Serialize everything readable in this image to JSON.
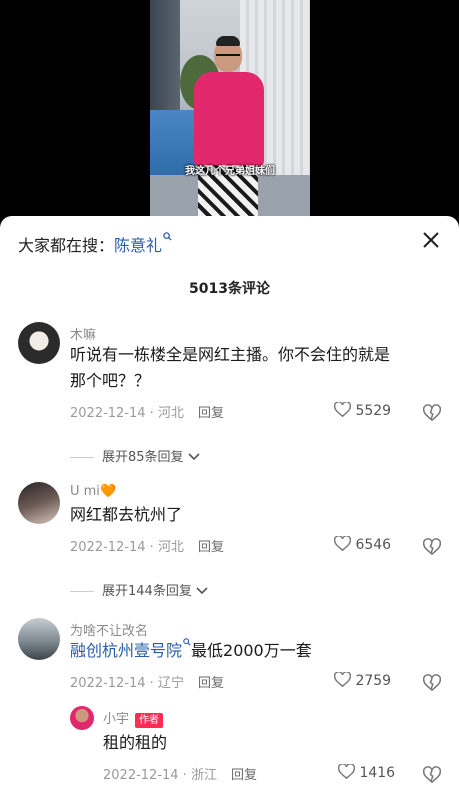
{
  "video": {
    "subtitle": "我这几个兄弟姐妹们"
  },
  "search": {
    "prefix": "大家都在搜：",
    "keyword": "陈意礼",
    "search_glyph": "ᵒ"
  },
  "comments_header": {
    "count_label": "5013条评论"
  },
  "comments": [
    {
      "user": "木嘛",
      "text_line1": "听说有一栋楼全是网红主播。你不会住的就是",
      "text_line2": "那个吧？？",
      "date_loc": "2022-12-14 · 河北",
      "reply_label": "回复",
      "likes": "5529",
      "expand_label": "展开85条回复"
    },
    {
      "user": "U mi",
      "user_emoji": "🧡",
      "text": "网红都去杭州了",
      "date_loc": "2022-12-14 · 河北",
      "reply_label": "回复",
      "likes": "6546",
      "expand_label": "展开144条回复"
    },
    {
      "user": "为啥不让改名",
      "link_text": "融创杭州壹号院",
      "text": "最低2000万一套",
      "date_loc": "2022-12-14 · 辽宁",
      "reply_label": "回复",
      "likes": "2759"
    }
  ],
  "reply": {
    "user": "小宇",
    "badge": "作者",
    "text": "租的租的",
    "date_loc": "2022-12-14 · 浙江",
    "reply_label": "回复",
    "likes": "1416"
  },
  "colors": {
    "link": "#2a5caa",
    "badge": "#fe2c55",
    "hoodie": "#e2286d"
  }
}
